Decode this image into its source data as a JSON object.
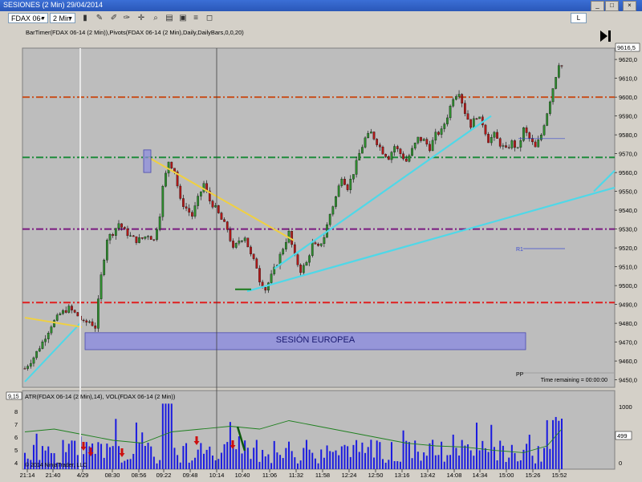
{
  "window": {
    "title": "SESIONES (2 Min)  29/04/2014",
    "buttons": [
      "_",
      "□",
      "×"
    ]
  },
  "toolbar": {
    "instrument": "FDAX 06-14",
    "interval": "2 Min",
    "mode_button": "L"
  },
  "chart_data": {
    "type": "candlestick",
    "indicator_label": "BarTimer(FDAX 06-14 (2 Min)),Pivots(FDAX 06-14 (2 Min),Daily,DailyBars,0,0,20)",
    "ylim": [
      9446,
      9626
    ],
    "y_ticks": [
      9450,
      9460,
      9470,
      9480,
      9490,
      9500,
      9510,
      9520,
      9530,
      9540,
      9550,
      9560,
      9570,
      9580,
      9590,
      9600,
      9610,
      9620
    ],
    "last_price": "9616,5",
    "x_ticks": [
      "21:14",
      "21:40",
      "4/29",
      "08:30",
      "08:56",
      "09:22",
      "09:48",
      "10:14",
      "10:40",
      "11:06",
      "11:32",
      "11:58",
      "12:24",
      "12:50",
      "13:16",
      "13:42",
      "14:08",
      "14:34",
      "15:00",
      "15:26",
      "15:52"
    ],
    "horizontal_levels": [
      {
        "value": 9600,
        "color": "#c8501e"
      },
      {
        "value": 9568,
        "color": "#1e8c3c"
      },
      {
        "value": 9530,
        "color": "#7a1a80"
      },
      {
        "value": 9491,
        "color": "#e01e1e"
      }
    ],
    "session_box_label": "SESIÓN EUROPEA",
    "pivot_labels": [
      "R1",
      "PP"
    ],
    "time_remaining": "Time remaining = 00:00:00",
    "price_path": [
      [
        0,
        9456
      ],
      [
        3,
        9462
      ],
      [
        6,
        9470
      ],
      [
        9,
        9479
      ],
      [
        12,
        9485
      ],
      [
        15,
        9488
      ],
      [
        18,
        9484
      ],
      [
        20,
        9480
      ],
      [
        22,
        9481
      ],
      [
        24,
        9478
      ],
      [
        26,
        9505
      ],
      [
        28,
        9525
      ],
      [
        30,
        9528
      ],
      [
        32,
        9533
      ],
      [
        34,
        9529
      ],
      [
        36,
        9526
      ],
      [
        38,
        9524
      ],
      [
        40,
        9525
      ],
      [
        42,
        9527
      ],
      [
        44,
        9524
      ],
      [
        46,
        9538
      ],
      [
        47,
        9552
      ],
      [
        49,
        9566
      ],
      [
        51,
        9561
      ],
      [
        53,
        9545
      ],
      [
        55,
        9541
      ],
      [
        57,
        9537
      ],
      [
        59,
        9546
      ],
      [
        61,
        9554
      ],
      [
        63,
        9545
      ],
      [
        65,
        9541
      ],
      [
        67,
        9535
      ],
      [
        69,
        9530
      ],
      [
        71,
        9519
      ],
      [
        73,
        9524
      ],
      [
        75,
        9526
      ],
      [
        77,
        9516
      ],
      [
        79,
        9510
      ],
      [
        80,
        9503
      ],
      [
        82,
        9498
      ],
      [
        84,
        9505
      ],
      [
        86,
        9512
      ],
      [
        88,
        9520
      ],
      [
        90,
        9528
      ],
      [
        92,
        9515
      ],
      [
        94,
        9508
      ],
      [
        96,
        9512
      ],
      [
        98,
        9522
      ],
      [
        100,
        9520
      ],
      [
        102,
        9526
      ],
      [
        104,
        9538
      ],
      [
        106,
        9547
      ],
      [
        108,
        9558
      ],
      [
        110,
        9552
      ],
      [
        112,
        9560
      ],
      [
        114,
        9570
      ],
      [
        116,
        9578
      ],
      [
        118,
        9581
      ],
      [
        120,
        9576
      ],
      [
        122,
        9571
      ],
      [
        124,
        9568
      ],
      [
        126,
        9574
      ],
      [
        128,
        9570
      ],
      [
        130,
        9566
      ],
      [
        132,
        9572
      ],
      [
        134,
        9578
      ],
      [
        136,
        9577
      ],
      [
        138,
        9573
      ],
      [
        140,
        9580
      ],
      [
        142,
        9582
      ],
      [
        144,
        9590
      ],
      [
        146,
        9600
      ],
      [
        148,
        9603
      ],
      [
        150,
        9592
      ],
      [
        152,
        9585
      ],
      [
        154,
        9590
      ],
      [
        156,
        9586
      ],
      [
        158,
        9577
      ],
      [
        160,
        9580
      ],
      [
        162,
        9575
      ],
      [
        164,
        9572
      ],
      [
        166,
        9576
      ],
      [
        168,
        9572
      ],
      [
        170,
        9583
      ],
      [
        172,
        9578
      ],
      [
        174,
        9573
      ],
      [
        176,
        9580
      ],
      [
        178,
        9592
      ],
      [
        180,
        9605
      ],
      [
        182,
        9618
      ],
      [
        183,
        9616.5
      ]
    ],
    "atr_panel": {
      "label": "ATR(FDAX 06-14 (2 Min),14), VOL(FDAX 06-14 (2 Min))",
      "atr_value_tag": "9,15",
      "y_ticks_left": [
        4,
        5,
        6,
        7,
        8
      ],
      "y_ticks_right": [
        0,
        500,
        1000
      ],
      "volume_tag": "499"
    },
    "copyright": "© 2014 NinjaTrader, LLC"
  }
}
